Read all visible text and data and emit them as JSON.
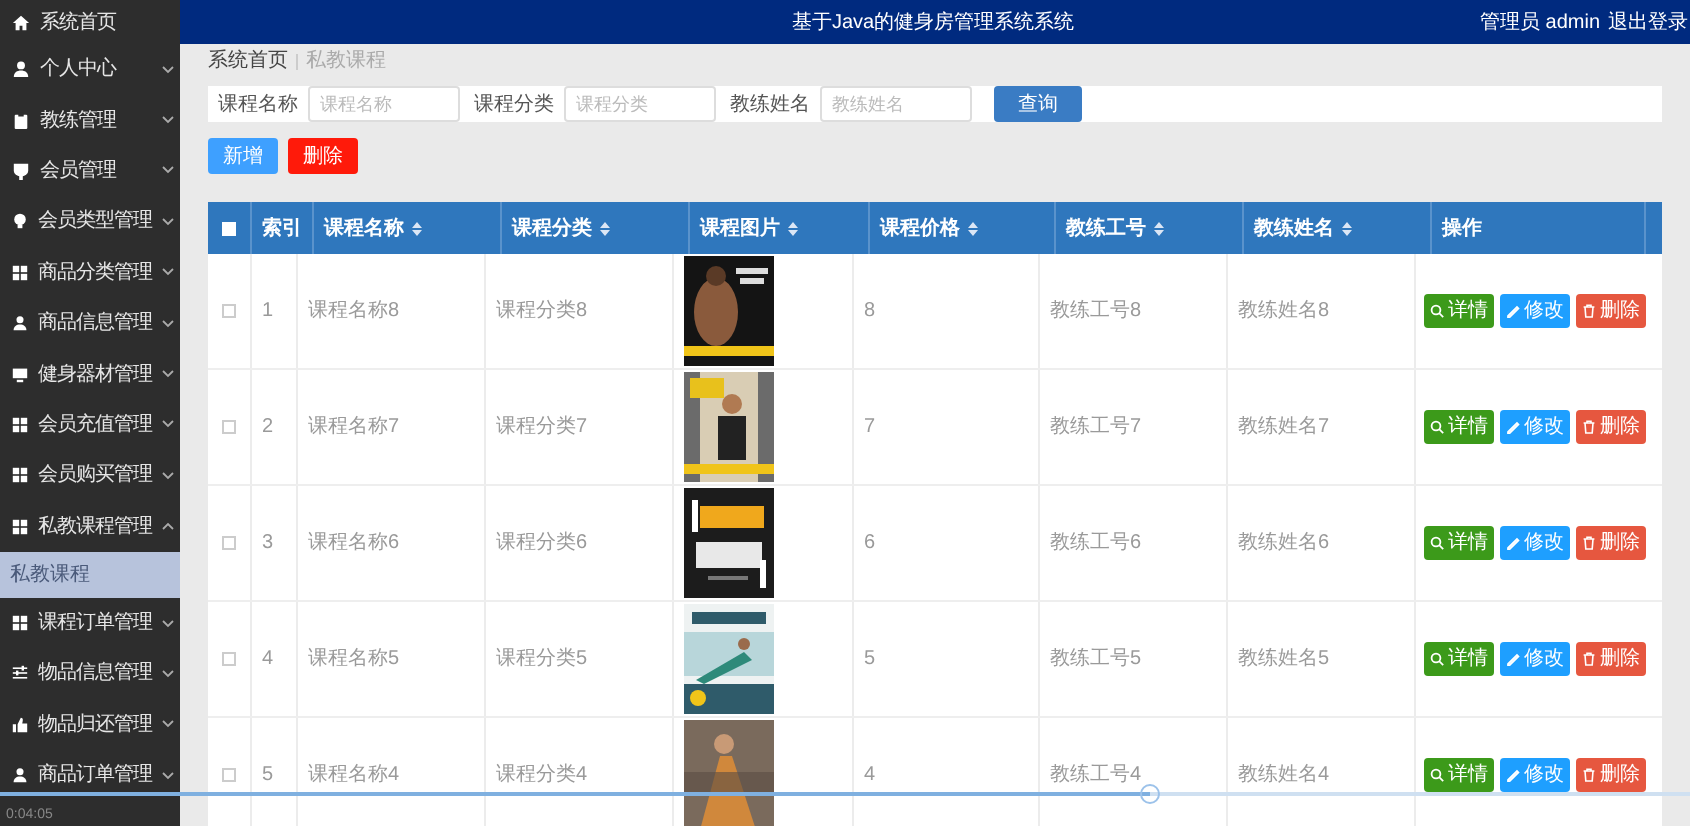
{
  "header": {
    "title": "基于Java的健身房管理系统系统",
    "user": "管理员 admin",
    "logout": "退出登录"
  },
  "sidebar": {
    "items": [
      {
        "kind": "link",
        "label": "系统首页"
      },
      {
        "kind": "menu",
        "label": "个人中心",
        "expanded": false
      },
      {
        "kind": "menu",
        "label": "教练管理",
        "expanded": false
      },
      {
        "kind": "menu",
        "label": "会员管理",
        "expanded": false
      },
      {
        "kind": "menu",
        "label": "会员类型管理",
        "expanded": false
      },
      {
        "kind": "menu",
        "label": "商品分类管理",
        "expanded": false
      },
      {
        "kind": "menu",
        "label": "商品信息管理",
        "expanded": false
      },
      {
        "kind": "menu",
        "label": "健身器材管理",
        "expanded": false
      },
      {
        "kind": "menu",
        "label": "会员充值管理",
        "expanded": false
      },
      {
        "kind": "menu",
        "label": "会员购买管理",
        "expanded": false
      },
      {
        "kind": "menu",
        "label": "私教课程管理",
        "expanded": true,
        "children": [
          {
            "label": "私教课程",
            "selected": true
          }
        ]
      },
      {
        "kind": "menu",
        "label": "课程订单管理",
        "expanded": false
      },
      {
        "kind": "menu",
        "label": "物品信息管理",
        "expanded": false
      },
      {
        "kind": "menu",
        "label": "物品归还管理",
        "expanded": false
      },
      {
        "kind": "menu",
        "label": "商品订单管理",
        "expanded": false
      }
    ]
  },
  "breadcrumb": [
    "系统首页",
    "私教课程"
  ],
  "search": {
    "fields": [
      {
        "label": "课程名称",
        "placeholder": "课程名称"
      },
      {
        "label": "课程分类",
        "placeholder": "课程分类"
      },
      {
        "label": "教练姓名",
        "placeholder": "教练姓名"
      }
    ],
    "button": "查询"
  },
  "actions": [
    {
      "kind": "add",
      "label": "新增"
    },
    {
      "kind": "delete",
      "label": "删除"
    }
  ],
  "table": {
    "select_all_checked": false,
    "columns": [
      {
        "label": "索引",
        "sortable": false
      },
      {
        "label": "课程名称",
        "sortable": true
      },
      {
        "label": "课程分类",
        "sortable": true
      },
      {
        "label": "课程图片",
        "sortable": true
      },
      {
        "label": "课程价格",
        "sortable": true
      },
      {
        "label": "教练工号",
        "sortable": true
      },
      {
        "label": "教练姓名",
        "sortable": true
      },
      {
        "label": "操作",
        "sortable": false
      }
    ],
    "rows": [
      {
        "checked": false,
        "index": "1",
        "name": "课程名称8",
        "category": "课程分类8",
        "price": "8",
        "coach_id": "教练工号8",
        "coach_name": "教练姓名8",
        "buttons": [
          {
            "kind": "detail",
            "label": "详情"
          },
          {
            "kind": "edit",
            "label": "修改"
          },
          {
            "kind": "remove",
            "label": "删除"
          }
        ]
      },
      {
        "checked": false,
        "index": "2",
        "name": "课程名称7",
        "category": "课程分类7",
        "price": "7",
        "coach_id": "教练工号7",
        "coach_name": "教练姓名7",
        "buttons": [
          {
            "kind": "detail",
            "label": "详情"
          },
          {
            "kind": "edit",
            "label": "修改"
          },
          {
            "kind": "remove",
            "label": "删除"
          }
        ]
      },
      {
        "checked": false,
        "index": "3",
        "name": "课程名称6",
        "category": "课程分类6",
        "price": "6",
        "coach_id": "教练工号6",
        "coach_name": "教练姓名6",
        "buttons": [
          {
            "kind": "detail",
            "label": "详情"
          },
          {
            "kind": "edit",
            "label": "修改"
          },
          {
            "kind": "remove",
            "label": "删除"
          }
        ]
      },
      {
        "checked": false,
        "index": "4",
        "name": "课程名称5",
        "category": "课程分类5",
        "price": "5",
        "coach_id": "教练工号5",
        "coach_name": "教练姓名5",
        "buttons": [
          {
            "kind": "detail",
            "label": "详情"
          },
          {
            "kind": "edit",
            "label": "修改"
          },
          {
            "kind": "remove",
            "label": "删除"
          }
        ]
      },
      {
        "checked": false,
        "index": "5",
        "name": "课程名称4",
        "category": "课程分类4",
        "price": "4",
        "coach_id": "教练工号4",
        "coach_name": "教练姓名4",
        "buttons": [
          {
            "kind": "detail",
            "label": "详情"
          },
          {
            "kind": "edit",
            "label": "修改"
          },
          {
            "kind": "remove",
            "label": "删除"
          }
        ]
      }
    ]
  },
  "video": {
    "time": "0:04:05",
    "level": 0.68
  }
}
